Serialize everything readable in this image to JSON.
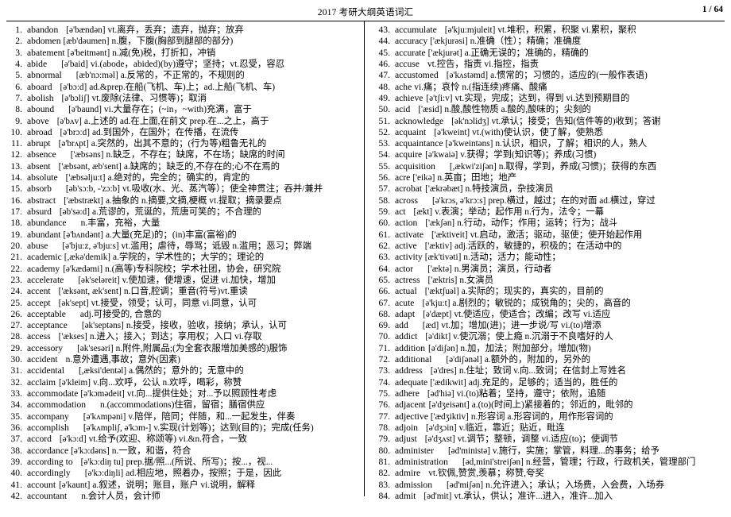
{
  "header": {
    "title": "2017 考研大纲英语词汇",
    "page_number": "1 / 64"
  },
  "columns": {
    "left": [
      {
        "num": "1.",
        "word": "abandon",
        "phon": "[ə'bændən]",
        "sense": "vt.离弃，丢弃；遗弃，抛弃；放弃",
        "gap": 2
      },
      {
        "num": "2.",
        "word": "abdomen",
        "phon": "[æb'dəumen]",
        "sense": "n.腹，下腹(胸部到腿部的部分)",
        "gap": 0
      },
      {
        "num": "3.",
        "word": "abatement",
        "phon": "[ə'beitmənt]",
        "sense": "n.减(免)税，打折扣，冲销",
        "gap": 0
      },
      {
        "num": "4.",
        "word": "abide",
        "phon": "[ə'baid]",
        "sense": "vi.(abode，abided)(by)遵守；坚持；vt.忍受，容忍",
        "gap": 3
      },
      {
        "num": "5.",
        "word": "abnormal",
        "phon": "[æb'nɔ:məl]",
        "sense": "a.反常的，不正常的，不规则的",
        "gap": 3
      },
      {
        "num": "6.",
        "word": "aboard",
        "phon": "[ə'bɔ:d]",
        "sense": "ad.&prep.在船(飞机、车)上；ad.上船(飞机、车)",
        "gap": 2
      },
      {
        "num": "7.",
        "word": "abolish",
        "phon": "[ə'bɔliʃ]",
        "sense": "vt.废除(法律、习惯等)；取消",
        "gap": 2
      },
      {
        "num": "8.",
        "word": "abound",
        "phon": "[ə'baund]",
        "sense": "vi.大量存在；(~in，~with)充满，富于",
        "gap": 3
      },
      {
        "num": "9.",
        "word": "above",
        "phon": "[ə'bʌv]",
        "sense": "a.上述的 ad.在上面,在前文 prep.在...之上，高于",
        "gap": 2
      },
      {
        "num": "10.",
        "word": "abroad",
        "phon": "[ə'brɔːd]",
        "sense": "ad.到国外，在国外；在传播，在流传",
        "gap": 2
      },
      {
        "num": "11.",
        "word": "abrupt",
        "phon": "[ə'brʌpt]",
        "sense": "a.突然的，出其不意的；(行为等)粗鲁无礼的",
        "gap": 2
      },
      {
        "num": "12.",
        "word": "absence",
        "phon": "['æbsəns]",
        "sense": "n.缺乏，不存在；缺席，不在场；缺席的时间",
        "gap": 3
      },
      {
        "num": "13.",
        "word": "absent",
        "phon": "['æbsənt, æb'sent]",
        "sense": "a.缺席的；缺乏的,不存在的;心不在焉的",
        "gap": 2
      },
      {
        "num": "14.",
        "word": "absolute",
        "phon": "['æbsəlju:t]",
        "sense": "a.绝对的，完全的；确实的，肯定的",
        "gap": 2
      },
      {
        "num": "15.",
        "word": "absorb",
        "phon": "[əb'sɔ:b, -'zɔ:b]",
        "sense": "vt.吸收(水、光、蒸汽等）；使全神贯注；吞并/兼并",
        "gap": 3
      },
      {
        "num": "16.",
        "word": "abstract",
        "phon": "['æbstrækt]",
        "sense": "a.抽象的 n.摘要,文摘,梗概 vt.提取；摘录要点",
        "gap": 2
      },
      {
        "num": "17.",
        "word": "absurd",
        "phon": "[əb'sə:d]",
        "sense": "a.荒谬的，荒诞的，荒唐可笑的；不合理的",
        "gap": 2
      },
      {
        "num": "18.",
        "word": "abundance",
        "phon": "",
        "sense": "n.丰富，充裕，大量",
        "gap": 3
      },
      {
        "num": "19.",
        "word": "abundant",
        "phon": "[ə'bʌndənt]",
        "sense": "a.大量(充足)的；(in)丰富(富裕)的",
        "gap": 0
      },
      {
        "num": "20.",
        "word": "abuse",
        "phon": "[ə'bju:z, ə'bju:s]",
        "sense": "vt.滥用；虐待，辱骂；诋毁 n.滥用；恶习；弊端",
        "gap": 3
      },
      {
        "num": "21.",
        "word": "academic",
        "phon": "[,ækə'demik]",
        "sense": "a.学院的，学术性的；大学的；理论的",
        "gap": 0
      },
      {
        "num": "22.",
        "word": "academy",
        "phon": "[ə'kædəmi]",
        "sense": "n.(高等)专科院校；学术社团，协会，研究院",
        "gap": 1
      },
      {
        "num": "23.",
        "word": "accelerate",
        "phon": "[ək'seləreit]",
        "sense": "v.使加速，使增速，促进 vi.加快，增加",
        "gap": 3
      },
      {
        "num": "24.",
        "word": "accent",
        "phon": "['æksənt, æk'sent]",
        "sense": "n.口音,腔调；重音(符号)vt.重读",
        "gap": 2
      },
      {
        "num": "25.",
        "word": "accept",
        "phon": "[ək'sept]",
        "sense": "vt.接受，领受；认可，同意 vi.同意，认可",
        "gap": 2
      },
      {
        "num": "26.",
        "word": "acceptable",
        "phon": "",
        "sense": "adj.可接受的, 合意的",
        "gap": 3
      },
      {
        "num": "27.",
        "word": "acceptance",
        "phon": "[ək'septəns]",
        "sense": "n.接受，接收，验收，接纳；承认，认可",
        "gap": 3
      },
      {
        "num": "28.",
        "word": "access",
        "phon": "['ækses]",
        "sense": "n.进入；接入；到达；享用权；入口 vi.存取",
        "gap": 2
      },
      {
        "num": "29.",
        "word": "accessory",
        "phon": "[ək'sesəri]",
        "sense": "n.附件,附属品;(为全套衣服增加美感的)服饰",
        "gap": 3
      },
      {
        "num": "30.",
        "word": "accident",
        "phon": "",
        "sense": "n.意外遭遇,事故；意外(因素)",
        "gap": 2
      },
      {
        "num": "31.",
        "word": "accidental",
        "phon": "[,æksi'dentəl]",
        "sense": "a.偶然的；意外的；无意中的",
        "gap": 3
      },
      {
        "num": "32.",
        "word": "acclaim",
        "phon": "[ə'kleim]",
        "sense": "v.向...欢呼，公认 n.欢呼，喝彩，称赞",
        "gap": 1
      },
      {
        "num": "33.",
        "word": "accommodate",
        "phon": "[ə'kɔmədeit]",
        "sense": "vt.向...提供住处；对...予以照顾性考虑",
        "gap": 0
      },
      {
        "num": "34.",
        "word": "accommodation",
        "phon": "",
        "sense": "n.(accommodations)住宿，留宿；膳宿供应",
        "gap": 3
      },
      {
        "num": "35.",
        "word": "accompany",
        "phon": "[ə'kʌmpəni]",
        "sense": "v.陪伴，陪同；伴随，和...一起发生，伴奏",
        "gap": 3
      },
      {
        "num": "36.",
        "word": "accomplish",
        "phon": "[ə'kʌmpliʃ, ə'kɔm-]",
        "sense": "v.实现(计划等)；达到(目的)；完成(任务)",
        "gap": 3
      },
      {
        "num": "37.",
        "word": "accord",
        "phon": "[ə'kɔ:d]",
        "sense": "vt.给予(欢迎、称颂等) vi.&n.符合，一致",
        "gap": 2
      },
      {
        "num": "38.",
        "word": "accordance",
        "phon": "[ə'kɔ:dəns]",
        "sense": "n.一致，和谐，符合",
        "gap": 0
      },
      {
        "num": "39.",
        "word": "according to",
        "phon": "[ə'kɔ:diŋ tu]",
        "sense": "prep.据/照...(所说、所写)；按...，视...",
        "gap": 2
      },
      {
        "num": "40.",
        "word": "accordingly",
        "phon": "[ə'kɔ:diŋli]",
        "sense": "ad.相应地，照着办，按照；于是，因此",
        "gap": 3
      },
      {
        "num": "41.",
        "word": "account",
        "phon": "[ə'kaunt]",
        "sense": "a.叙述，说明；账目，账户 vi.说明，解释",
        "gap": 1
      },
      {
        "num": "42.",
        "word": "accountant",
        "phon": "",
        "sense": "n.会计人员，会计师",
        "gap": 3
      }
    ],
    "right": [
      {
        "num": "43.",
        "word": "accumulate",
        "phon": "[ə'kju:mjuleit]",
        "sense": "vt.堆积，积累，积聚 vi.累积，聚积",
        "gap": 2
      },
      {
        "num": "44.",
        "word": "accuracy",
        "phon": "['ækjurəsi]",
        "sense": "n.准确（性）；精确；准确度",
        "gap": 0
      },
      {
        "num": "45.",
        "word": "accurate",
        "phon": "['ækjurət]",
        "sense": "a.正确无误的；准确的，精确的",
        "gap": 0
      },
      {
        "num": "46.",
        "word": "accuse",
        "phon": "",
        "sense": "vt.控告，指责 vi.指控，指责",
        "gap": 2
      },
      {
        "num": "47.",
        "word": "accustomed",
        "phon": "[ə'kʌstəmd]",
        "sense": "a.惯常的；习惯的，适应的(一般作表语)",
        "gap": 2
      },
      {
        "num": "48.",
        "word": "ache",
        "phon": "",
        "sense": "vi.痛；哀怜 n.(指连续)疼痛、酸痛",
        "gap": 0
      },
      {
        "num": "49.",
        "word": "achieve",
        "phon": "[ə'tʃi:v]",
        "sense": "vt.实现，完成；达到，得到 vi.达到预期目的",
        "gap": 1
      },
      {
        "num": "50.",
        "word": "acid",
        "phon": "['æsid]",
        "sense": "n.酸,酸性物质 a.酸的,酸味的；尖刻的",
        "gap": 2
      },
      {
        "num": "51.",
        "word": "acknowledge",
        "phon": "[ək'nɔlidʒ]",
        "sense": "vt.承认；接受；告知(信件等的)收到；答谢",
        "gap": 2
      },
      {
        "num": "52.",
        "word": "acquaint",
        "phon": "[ə'kweint]",
        "sense": "vt.(with)使认识，使了解，使熟悉",
        "gap": 2
      },
      {
        "num": "53.",
        "word": "acquaintance",
        "phon": "[ə'kweintəns]",
        "sense": "n.认识，相识，了解；相识的人，熟人",
        "gap": 0
      },
      {
        "num": "54.",
        "word": "acquire",
        "phon": "[ə'kwaiə]",
        "sense": "v.获得；学到(知识等)；养成(习惯)",
        "gap": 1
      },
      {
        "num": "55.",
        "word": "acquisition",
        "phon": "[,ækwi'ziʃən]",
        "sense": "n.取得，学到，养成(习惯)；获得的东西",
        "gap": 3
      },
      {
        "num": "56.",
        "word": "acre",
        "phon": "['eikə]",
        "sense": "n.英亩；田地；地产",
        "gap": 0
      },
      {
        "num": "57.",
        "word": "acrobat",
        "phon": "['ækrəbæt]",
        "sense": "n.特技演员，杂技演员",
        "gap": 1
      },
      {
        "num": "58.",
        "word": "across",
        "phon": "[ə'krɔs, ə'krɔ:s]",
        "sense": "prep.横过，越过；在的对面 ad.横过，穿过",
        "gap": 3
      },
      {
        "num": "59.",
        "word": "act",
        "phon": "[ækt]",
        "sense": "v.表演；举动；起作用 n.行为，法令；一幕",
        "gap": 2
      },
      {
        "num": "60.",
        "word": "action",
        "phon": "['ækʃən]",
        "sense": "n.行动，动作；作用；运转；行为；战斗",
        "gap": 2
      },
      {
        "num": "61.",
        "word": "activate",
        "phon": "['æktiveit]",
        "sense": "vt.启动，激活；驱动，驱使；使开始起作用",
        "gap": 2
      },
      {
        "num": "62.",
        "word": "active",
        "phon": "['æktiv]",
        "sense": "adj.活跃的，敏捷的，积极的；在活动中的",
        "gap": 2
      },
      {
        "num": "63.",
        "word": "activity",
        "phon": "[æk'tivəti]",
        "sense": "n.活动；活力；能动性；",
        "gap": 0
      },
      {
        "num": "64.",
        "word": "actor",
        "phon": "['æktə]",
        "sense": "n.男演员；演员，行动者",
        "gap": 3
      },
      {
        "num": "65.",
        "word": "actress",
        "phon": "['æktris]",
        "sense": "n.女演员",
        "gap": 2
      },
      {
        "num": "66.",
        "word": "actual",
        "phon": "['æktʃuəl]",
        "sense": "a.实际的；现实的，真实的，目前的",
        "gap": 2
      },
      {
        "num": "67.",
        "word": "acute",
        "phon": "[ə'kju:t]",
        "sense": "a.剧烈的；敏锐的；成锐角的；尖的，高音的",
        "gap": 2
      },
      {
        "num": "68.",
        "word": "adapt",
        "phon": "[ə'dæpt]",
        "sense": "vt.使适应，使适合；改编；改写 vi.适应",
        "gap": 2
      },
      {
        "num": "69.",
        "word": "add",
        "phon": "[æd]",
        "sense": "vt.加；增加(进)；进一步说/写 vi.(to)增添",
        "gap": 3
      },
      {
        "num": "70.",
        "word": "addict",
        "phon": "[ə'dikt]",
        "sense": "v.使沉溺；使上瘾 n.沉溺于不良嗜好的人",
        "gap": 2
      },
      {
        "num": "71.",
        "word": "addition",
        "phon": "[ə'diʃən]",
        "sense": "n.加，加法；附加部分，增加(物)",
        "gap": 1
      },
      {
        "num": "72.",
        "word": "additional",
        "phon": "[ə'diʃənəl]",
        "sense": "a.额外的，附加的，另外的",
        "gap": 3
      },
      {
        "num": "73.",
        "word": "address",
        "phon": "[ə'dres]",
        "sense": "n.住址；致词 v.向...致词；在信封上写姓名",
        "gap": 2
      },
      {
        "num": "74.",
        "word": "adequate",
        "phon": "['ædikwit]",
        "sense": "adj.充足的，足够的；适当的，胜任的",
        "gap": 0
      },
      {
        "num": "75.",
        "word": "adhere",
        "phon": "[əd'hiə]",
        "sense": "vi.(to)粘着；坚持，遵守；依附，追随",
        "gap": 2
      },
      {
        "num": "76.",
        "word": "adjacent",
        "phon": "[ə'dʒeisənt]",
        "sense": "a.(to)(时间上)紧接着的；邻近的，毗邻的",
        "gap": 1
      },
      {
        "num": "77.",
        "word": "adjective",
        "phon": "['ædʒiktiv]",
        "sense": "n.形容词 a.形容词的，用作形容词的",
        "gap": 0
      },
      {
        "num": "78.",
        "word": "adjoin",
        "phon": "[ə'dʒɔin]",
        "sense": "v.临近，靠近；贴近，毗连",
        "gap": 2
      },
      {
        "num": "79.",
        "word": "adjust",
        "phon": "[ə'dʒʌst]",
        "sense": "vt.调节；整顿，调整 vi.适应(to)；使调节",
        "gap": 2
      },
      {
        "num": "80.",
        "word": "administer",
        "phon": "[əd'ministə]",
        "sense": "v.施行，实施；掌管，料理...的事务；给予",
        "gap": 3
      },
      {
        "num": "81.",
        "word": "administration",
        "phon": "[əd,mini'streiʃən]",
        "sense": "n.经营，管理；行政，行政机关，管理部门",
        "gap": 3
      },
      {
        "num": "82.",
        "word": "admire",
        "phon": "",
        "sense": "vt.钦佩,赞赏,羡慕；称赞,夸奖",
        "gap": 2
      },
      {
        "num": "83.",
        "word": "admission",
        "phon": "[əd'miʃən]",
        "sense": "n.允许进入；承认；入场费，入会费，入场券",
        "gap": 3
      },
      {
        "num": "84.",
        "word": "admit",
        "phon": "[əd'mit]",
        "sense": "vt.承认，供认；准许...进入，准许...加入",
        "gap": 2
      }
    ]
  }
}
